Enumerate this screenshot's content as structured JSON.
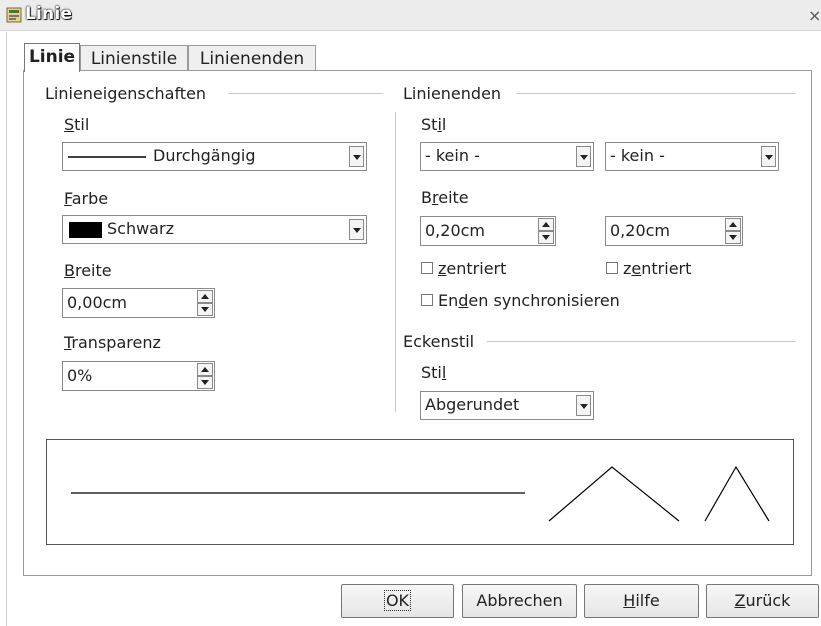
{
  "window": {
    "title": "Linie",
    "close_glyph": "×"
  },
  "tabs": [
    {
      "label": "Linie",
      "active": true
    },
    {
      "label": "Linienstile",
      "active": false
    },
    {
      "label": "Linienenden",
      "active": false
    }
  ],
  "line_props": {
    "group_title": "Linieneigenschaften",
    "style_label": "Stil",
    "style_value": "Durchgängig",
    "color_label": "Farbe",
    "color_value": "Schwarz",
    "color_swatch": "#000000",
    "width_label": "Breite",
    "width_value": "0,00cm",
    "transparency_label": "Transparenz",
    "transparency_value": "0%"
  },
  "line_ends": {
    "group_title": "Linienenden",
    "style_label": "Stil",
    "start_style": "- kein -",
    "end_style": "- kein -",
    "width_label": "Breite",
    "start_width": "0,20cm",
    "end_width": "0,20cm",
    "centered_label": "zentriert",
    "sync_label": "Enden synchronisieren"
  },
  "corner": {
    "group_title": "Eckenstil",
    "style_label": "Stil",
    "style_value": "Abgerundet"
  },
  "buttons": {
    "ok": "OK",
    "cancel": "Abbrechen",
    "help": "Hilfe",
    "reset": "Zurück"
  }
}
